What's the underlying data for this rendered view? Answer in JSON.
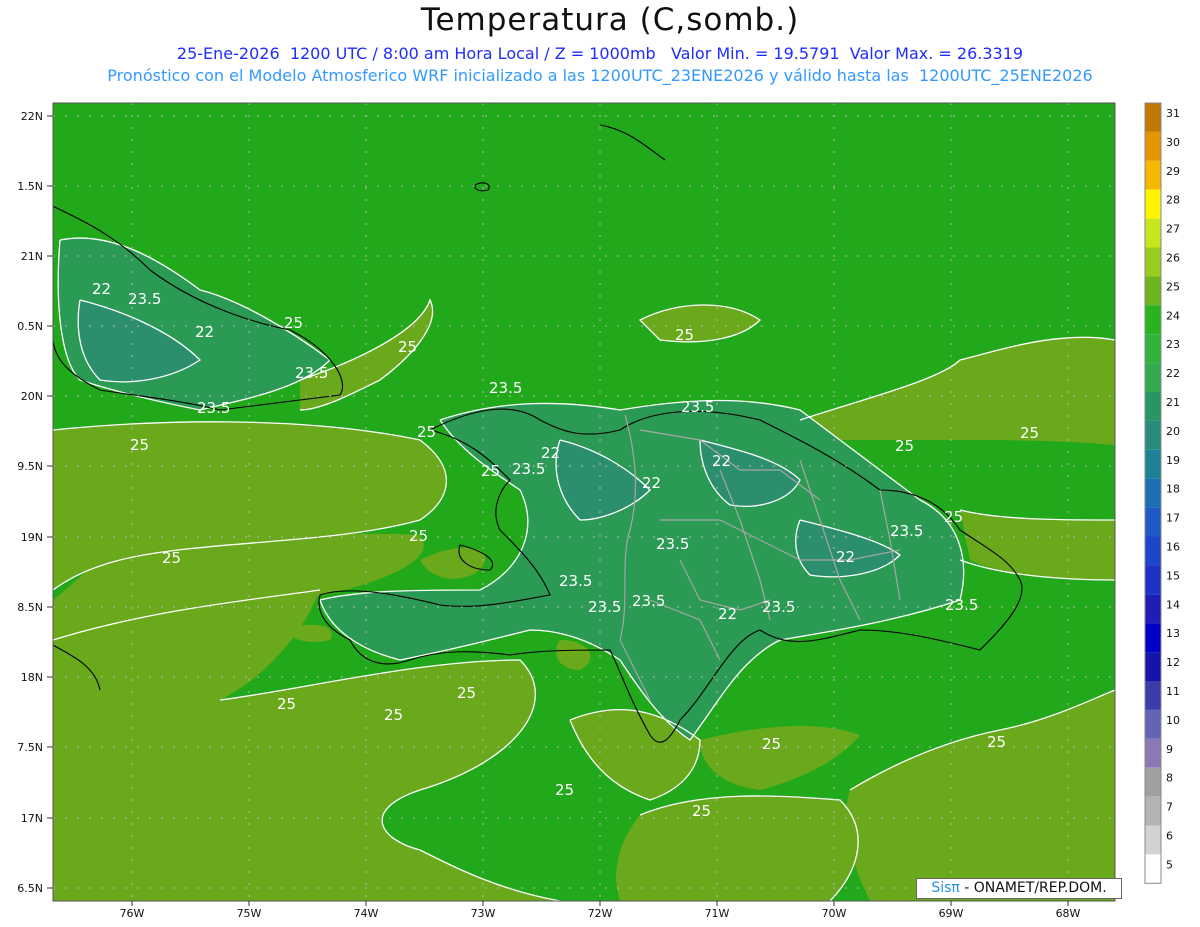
{
  "header": {
    "title": "Temperatura (C,somb.)",
    "line1": "25-Ene-2026  1200 UTC / 8:00 am Hora Local / Z = 1000mb   Valor Min. = 19.5791  Valor Max. = 26.3319",
    "line2": "Pronóstico con el Modelo Atmosferico WRF inicializado a las 1200UTC_23ENE2026 y válido hasta las  1200UTC_25ENE2026"
  },
  "axes": {
    "lat_labels": [
      "22N",
      "1.5N",
      "21N",
      "0.5N",
      "20N",
      "9.5N",
      "19N",
      "8.5N",
      "18N",
      "7.5N",
      "17N",
      "6.5N"
    ],
    "lon_labels": [
      "76W",
      "75W",
      "74W",
      "73W",
      "72W",
      "71W",
      "70W",
      "69W",
      "68W"
    ]
  },
  "colorbar": {
    "levels": [
      "31",
      "30",
      "29",
      "28",
      "27",
      "26",
      "25",
      "24",
      "23",
      "22",
      "21",
      "20",
      "19",
      "18",
      "17",
      "16",
      "15",
      "14",
      "13",
      "12",
      "11",
      "10",
      "9",
      "8",
      "7",
      "6",
      "5"
    ],
    "colors": [
      "#c07800",
      "#e39400",
      "#f5b800",
      "#fff500",
      "#c8e61e",
      "#96cd1e",
      "#6eb41e",
      "#28b41e",
      "#32b43c",
      "#32aa50",
      "#289664",
      "#288c7d",
      "#1e8296",
      "#1e6eb4",
      "#1e5ac8",
      "#1e46c8",
      "#1e32c8",
      "#1e1eb4",
      "#0000c8",
      "#1414aa",
      "#3c3caa",
      "#6464b4",
      "#8c78b4",
      "#a0a0a0",
      "#b4b4b4",
      "#d2d2d2",
      "#ffffff"
    ]
  },
  "contour_labels": [
    "22",
    "23.5",
    "22",
    "25",
    "25",
    "23.5",
    "23.5",
    "25",
    "23.5",
    "25",
    "23.5",
    "25",
    "25",
    "22",
    "25",
    "23.5",
    "22",
    "22",
    "25",
    "25",
    "23.5",
    "22",
    "23.5",
    "25",
    "23.5",
    "23.5",
    "22",
    "23.5",
    "23.5",
    "25",
    "25",
    "25",
    "25",
    "25",
    "25",
    "25",
    "25",
    "23.5"
  ],
  "credit": {
    "brand": "Sisπ",
    "text": " - ONAMET/REP.DOM."
  }
}
